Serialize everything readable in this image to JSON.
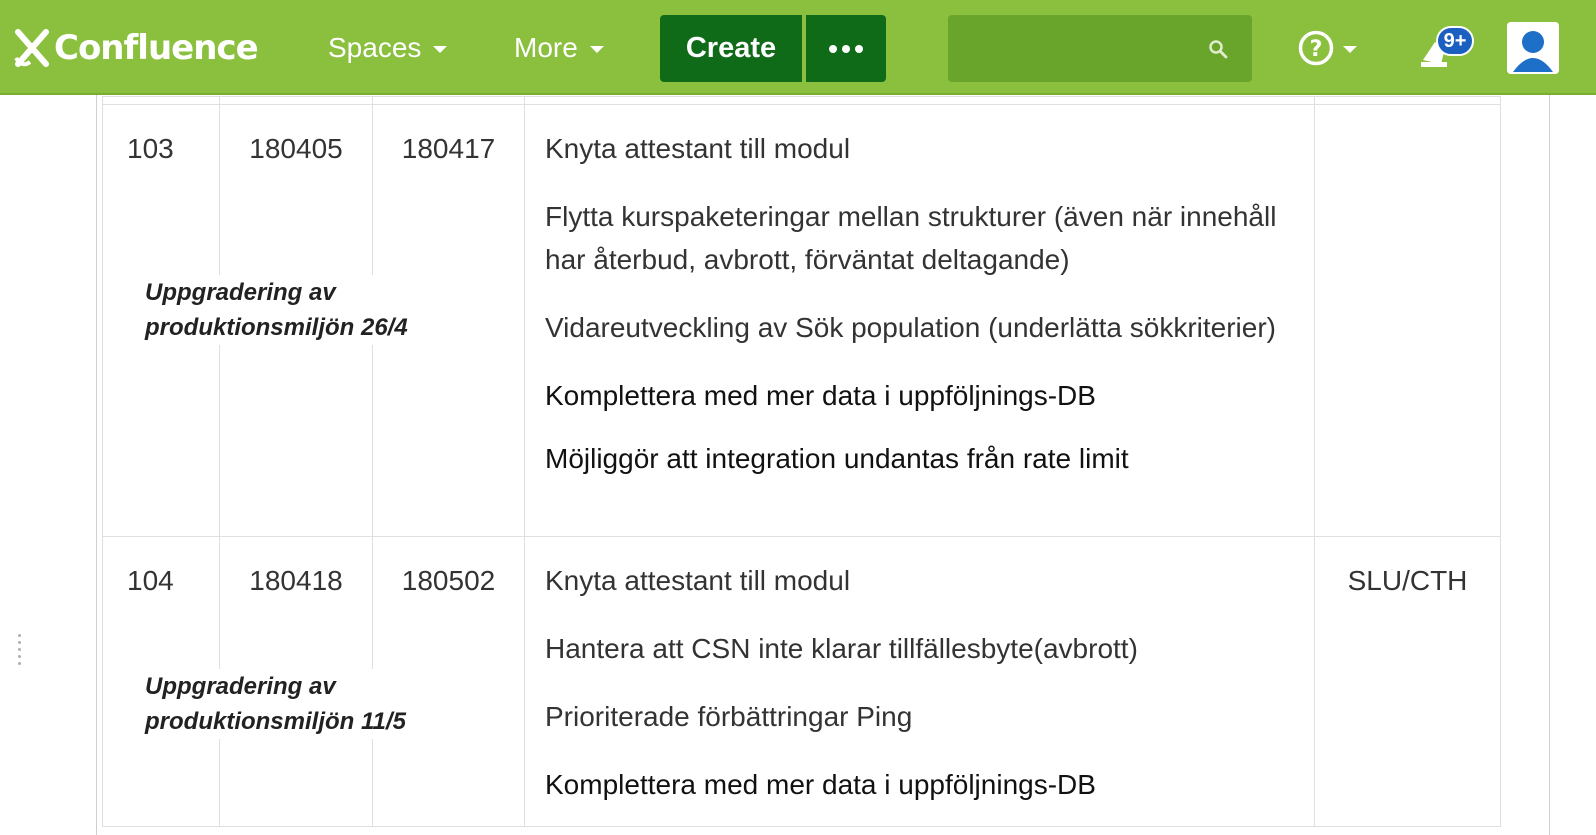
{
  "topbar": {
    "logo_text": "Confluence",
    "nav": [
      {
        "label": "Spaces"
      },
      {
        "label": "More"
      }
    ],
    "create_label": "Create",
    "notification_badge": "9+",
    "brand_color": "#8ac03e",
    "button_color": "#106b19"
  },
  "table": {
    "rows": [
      {
        "id": "103",
        "start": "180405",
        "end": "180417",
        "note": "Uppgradering av produktionsmiljön 26/4",
        "items": [
          "Knyta attestant till modul",
          "Flytta kurspaketeringar mellan strukturer (även när innehåll har återbud, avbrott, förväntat deltagande)",
          "Vidareutveckling av Sök population (underlätta sökkriterier)",
          "Komplettera med mer data i uppföljnings-DB",
          "Möjliggör att integration undantas från rate limit"
        ],
        "owner": ""
      },
      {
        "id": "104",
        "start": "180418",
        "end": "180502",
        "note": "Uppgradering av produktionsmiljön 11/5",
        "items": [
          "Knyta attestant till modul",
          "Hantera att CSN inte klarar tillfällesbyte(avbrott)",
          "Prioriterade förbättringar Ping",
          "Komplettera med mer data i uppföljnings-DB"
        ],
        "owner": "SLU/CTH"
      }
    ]
  }
}
